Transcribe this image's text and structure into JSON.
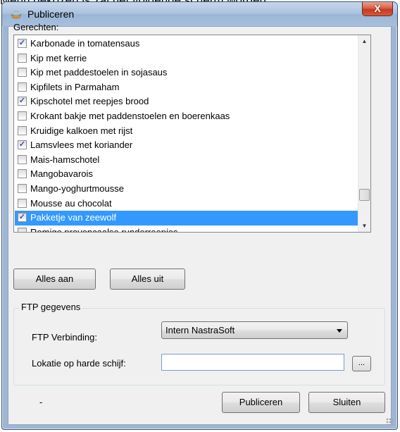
{
  "background_text": "Menu gekozen is zal het volgende scherm worden",
  "window": {
    "title": "Publiceren",
    "close_glyph": "X"
  },
  "dishes": {
    "label": "Gerechten:",
    "items": [
      {
        "label": "Karbonade in tomatensaus",
        "checked": true,
        "selected": false
      },
      {
        "label": "Kip met kerrie",
        "checked": false,
        "selected": false
      },
      {
        "label": "Kip met paddestoelen in sojasaus",
        "checked": false,
        "selected": false
      },
      {
        "label": "Kipfilets in Parmaham",
        "checked": false,
        "selected": false
      },
      {
        "label": "Kipschotel met reepjes brood",
        "checked": true,
        "selected": false
      },
      {
        "label": "Krokant bakje met paddenstoelen en boerenkaas",
        "checked": false,
        "selected": false
      },
      {
        "label": "Kruidige kalkoen met rijst",
        "checked": false,
        "selected": false
      },
      {
        "label": "Lamsvlees met koriander",
        "checked": true,
        "selected": false
      },
      {
        "label": "Mais-hamschotel",
        "checked": false,
        "selected": false
      },
      {
        "label": "Mangobavarois",
        "checked": false,
        "selected": false
      },
      {
        "label": "Mango-yoghurtmousse",
        "checked": false,
        "selected": false
      },
      {
        "label": "Mousse au chocolat",
        "checked": false,
        "selected": false
      },
      {
        "label": "Pakketje van zeewolf",
        "checked": true,
        "selected": true
      },
      {
        "label": "Romige provençaalse runderreepjes",
        "checked": false,
        "selected": false
      }
    ]
  },
  "buttons": {
    "select_all": "Alles aan",
    "deselect_all": "Alles uit",
    "publish": "Publiceren",
    "close": "Sluiten",
    "browse": "..."
  },
  "ftp": {
    "group_title": "FTP gegevens",
    "connection_label": "FTP Verbinding:",
    "connection_value": "Intern NastraSoft",
    "location_label": "Lokatie op harde schijf:",
    "location_value": ""
  },
  "status_text": "-",
  "colors": {
    "selection": "#3399ff",
    "close_button": "#c8391f",
    "titlebar": "#a9c1de"
  }
}
